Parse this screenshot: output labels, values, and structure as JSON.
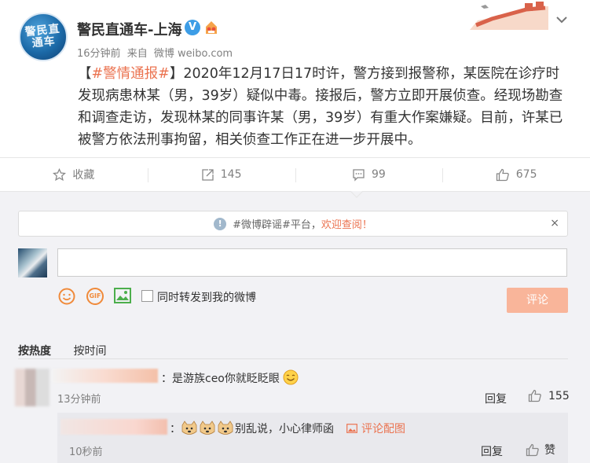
{
  "post": {
    "username": "警民直通车-上海",
    "avatar_text": "警民直通车",
    "time": "16分钟前",
    "source_prefix": "来自",
    "source": "微博 weibo.com",
    "bracket_open": "【",
    "tag": "#警情通报#",
    "bracket_close": "】",
    "text": "2020年12月17日17时许，警方接到报警称，某医院在诊疗时发现病患林某（男，39岁）疑似中毒。接报后，警方立即开展侦查。经现场勘查和调查走访，发现林某的同事许某（男，39岁）有重大作案嫌疑。目前，许某已被警方依法刑事拘留，相关侦查工作正在进一步开展中。"
  },
  "actions": {
    "favorite_label": "收藏",
    "repost_count": "145",
    "comment_count": "99",
    "like_count": "675"
  },
  "notice": {
    "link_text": "#微博辟谣#平台，",
    "highlight": "欢迎查阅！",
    "close": "×"
  },
  "composer": {
    "repost_label": "同时转发到我的微博",
    "submit_label": "评论",
    "gif_label": "GIF"
  },
  "sort": {
    "hot": "按热度",
    "time": "按时间"
  },
  "comments": [
    {
      "text": "：是游族ceo你就眨眨眼",
      "time": "13分钟前",
      "reply_label": "回复",
      "likes": "155"
    },
    {
      "text": "别乱说，小心律师函",
      "image_link": "评论配图",
      "time": "10秒前",
      "reply_label": "回复",
      "like_label": "赞"
    }
  ],
  "colors": {
    "accent": "#eb7350",
    "button": "#f9b59a",
    "verify": "#3d9de6"
  },
  "icons": [
    "star-icon",
    "repost-icon",
    "comment-icon",
    "thumbs-up-icon",
    "info-icon",
    "emoji-icon",
    "gif-icon",
    "image-icon",
    "chevron-down-icon"
  ]
}
